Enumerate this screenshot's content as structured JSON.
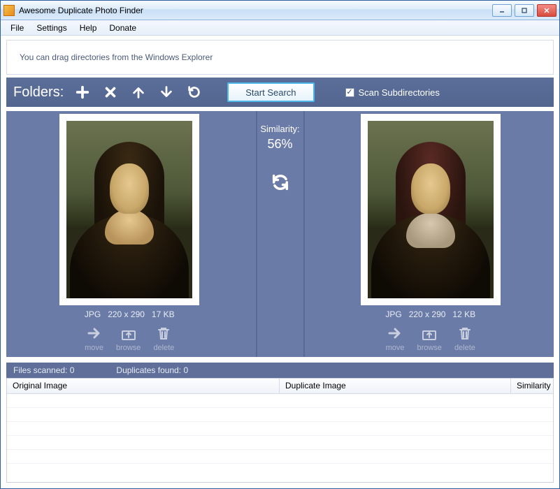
{
  "window": {
    "title": "Awesome Duplicate Photo Finder"
  },
  "menu": {
    "file": "File",
    "settings": "Settings",
    "help": "Help",
    "donate": "Donate"
  },
  "drop_hint": "You can drag directories from the Windows Explorer",
  "toolbar": {
    "folders_label": "Folders:",
    "start_search": "Start Search",
    "scan_subdirs": "Scan Subdirectories",
    "scan_subdirs_checked": true
  },
  "similarity": {
    "label": "Similarity:",
    "value": "56%"
  },
  "left": {
    "format": "JPG",
    "dimensions": "220 x 290",
    "size": "17 KB",
    "move": "move",
    "browse": "browse",
    "delete": "delete"
  },
  "right": {
    "format": "JPG",
    "dimensions": "220 x 290",
    "size": "12 KB",
    "move": "move",
    "browse": "browse",
    "delete": "delete"
  },
  "status": {
    "files_scanned_label": "Files scanned:",
    "files_scanned_value": "0",
    "duplicates_found_label": "Duplicates found:",
    "duplicates_found_value": "0"
  },
  "table": {
    "col_original": "Original Image",
    "col_duplicate": "Duplicate Image",
    "col_similarity": "Similarity"
  }
}
